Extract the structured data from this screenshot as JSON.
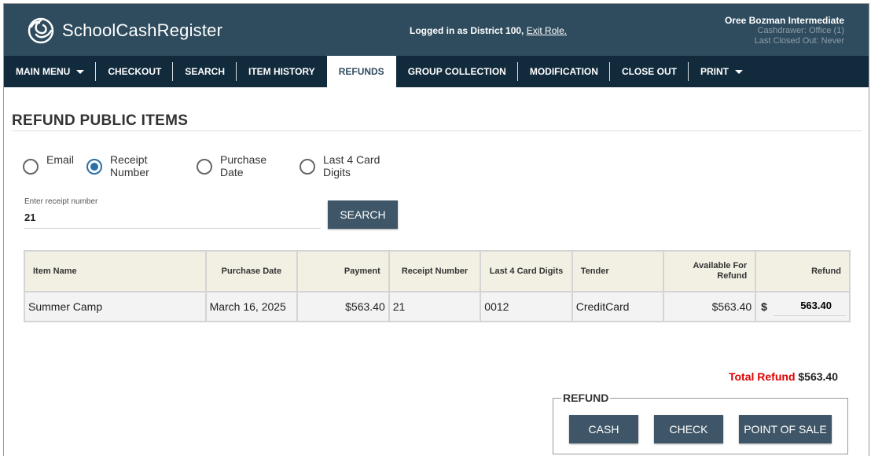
{
  "app": {
    "name": "SchoolCashRegister"
  },
  "session": {
    "logged_in_prefix": "Logged in as District 100, ",
    "exit_role": "Exit Role.",
    "user_name": "Oree Bozman Intermediate",
    "cashdrawer": "Cashdrawer: Office (1)",
    "last_closed": "Last Closed Out: Never"
  },
  "nav": {
    "items": [
      {
        "label": "MAIN MENU"
      },
      {
        "label": "CHECKOUT"
      },
      {
        "label": "SEARCH"
      },
      {
        "label": "ITEM HISTORY"
      },
      {
        "label": "REFUNDS"
      },
      {
        "label": "GROUP COLLECTION"
      },
      {
        "label": "MODIFICATION"
      },
      {
        "label": "CLOSE OUT"
      },
      {
        "label": "PRINT"
      }
    ],
    "active": "REFUNDS"
  },
  "page": {
    "title": "REFUND PUBLIC ITEMS"
  },
  "search": {
    "options": [
      {
        "label": "Email"
      },
      {
        "label": "Receipt Number"
      },
      {
        "label": "Purchase Date"
      },
      {
        "label": "Last 4 Card Digits"
      }
    ],
    "selected": "Receipt Number",
    "input_caption": "Enter receipt number",
    "input_value": "21",
    "button_label": "SEARCH"
  },
  "table": {
    "headers": [
      "Item Name",
      "Purchase Date",
      "Payment",
      "Receipt Number",
      "Last 4 Card Digits",
      "Tender",
      "Available For Refund",
      "Refund"
    ],
    "rows": [
      {
        "item_name": "Summer Camp",
        "purchase_date": "March 16, 2025",
        "payment": "$563.40",
        "receipt_number": "21",
        "last4": "0012",
        "tender": "CreditCard",
        "available": "$563.40",
        "currency": "$",
        "refund": "563.40"
      }
    ]
  },
  "totals": {
    "label": "Total Refund",
    "value": "$563.40"
  },
  "refund_panel": {
    "legend": "REFUND",
    "buttons": [
      "CASH",
      "CHECK",
      "POINT OF SALE"
    ]
  },
  "colors": {
    "header_bg": "#2f4c5e",
    "nav_bg": "#122b3c",
    "button_bg": "#3e5667",
    "total_label": "#e00000",
    "radio_selected": "#2a6fa6"
  }
}
